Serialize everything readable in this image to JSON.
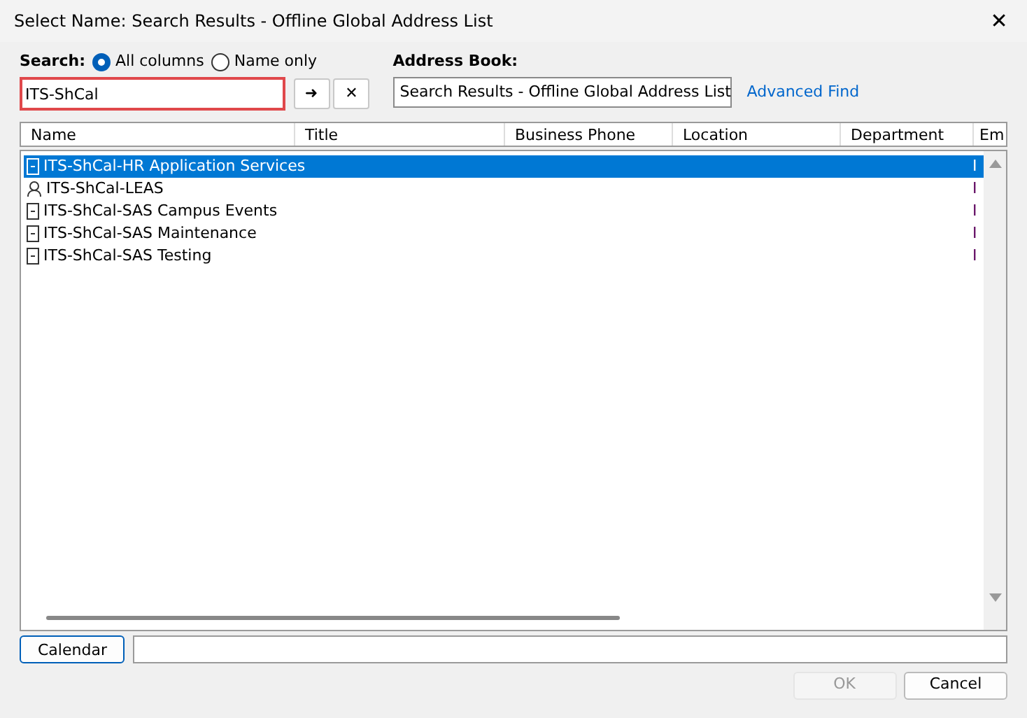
{
  "window": {
    "title": "Select Name: Search Results - Offline Global Address List",
    "close": "✕"
  },
  "search": {
    "label": "Search:",
    "scope": [
      {
        "label": "All columns",
        "selected": true
      },
      {
        "label": "Name only",
        "selected": false
      }
    ],
    "value": "ITS-ShCal",
    "go": "➜",
    "clear": "✕"
  },
  "address_book": {
    "label": "Address Book:",
    "value": "Search Results - Offline Global Address List",
    "link": "Advanced Find"
  },
  "table": {
    "columns": [
      "Name",
      "Title",
      "Business Phone",
      "Location",
      "Department",
      "Em"
    ],
    "rows": [
      {
        "kind": "group",
        "name": "ITS-ShCal-HR Application Services",
        "email": "I",
        "selected": true
      },
      {
        "kind": "person",
        "name": "ITS-ShCal-LEAS",
        "email": "I",
        "selected": false
      },
      {
        "kind": "group",
        "name": "ITS-ShCal-SAS Campus Events",
        "email": "I",
        "selected": false
      },
      {
        "kind": "group",
        "name": "ITS-ShCal-SAS Maintenance",
        "email": "I",
        "selected": false
      },
      {
        "kind": "group",
        "name": "ITS-ShCal-SAS Testing",
        "email": "I",
        "selected": false
      }
    ]
  },
  "calendar_button": "Calendar",
  "buttons": [
    {
      "label": "OK",
      "disabled": true
    },
    {
      "label": "Cancel",
      "disabled": false
    }
  ]
}
